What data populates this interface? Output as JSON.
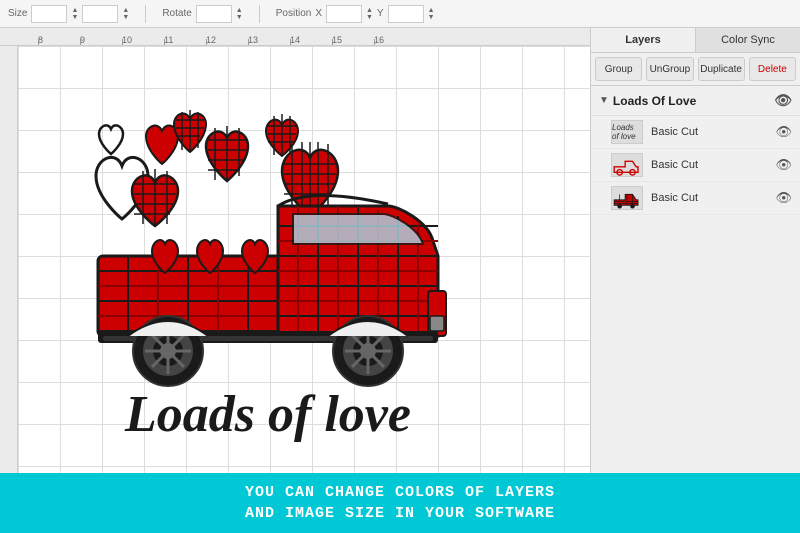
{
  "toolbar": {
    "size_label": "Size",
    "rotate_label": "Rotate",
    "position_label": "Position",
    "x_label": "X",
    "y_label": "Y",
    "w_value": "",
    "h_value": ""
  },
  "panel": {
    "tabs": [
      {
        "label": "Layers",
        "active": true
      },
      {
        "label": "Color Sync",
        "active": false
      }
    ],
    "actions": [
      {
        "label": "Group"
      },
      {
        "label": "UnGroup"
      },
      {
        "label": "Duplicate"
      },
      {
        "label": "Delete"
      }
    ],
    "main_layer": {
      "name": "Loads Of Love",
      "arrow": "▼"
    },
    "sub_layers": [
      {
        "name": "Basic Cut",
        "thumb_type": "text"
      },
      {
        "name": "Basic Cut",
        "thumb_type": "truck-outline"
      },
      {
        "name": "Basic Cut",
        "thumb_type": "truck-filled"
      }
    ]
  },
  "banner": {
    "line1": "YOU CAN CHANGE COLORS OF LAYERS",
    "line2": "AND IMAGE SIZE IN YOUR SOFTWARE"
  },
  "ruler": {
    "top_numbers": [
      "8",
      "9",
      "10",
      "11",
      "12",
      "13",
      "14",
      "15",
      "16"
    ],
    "left_numbers": [
      "",
      "",
      "",
      "",
      "",
      "",
      "",
      "",
      "",
      ""
    ]
  },
  "icons": {
    "eye": "👁",
    "arrow_down": "▼",
    "arrow_up": "▲"
  }
}
